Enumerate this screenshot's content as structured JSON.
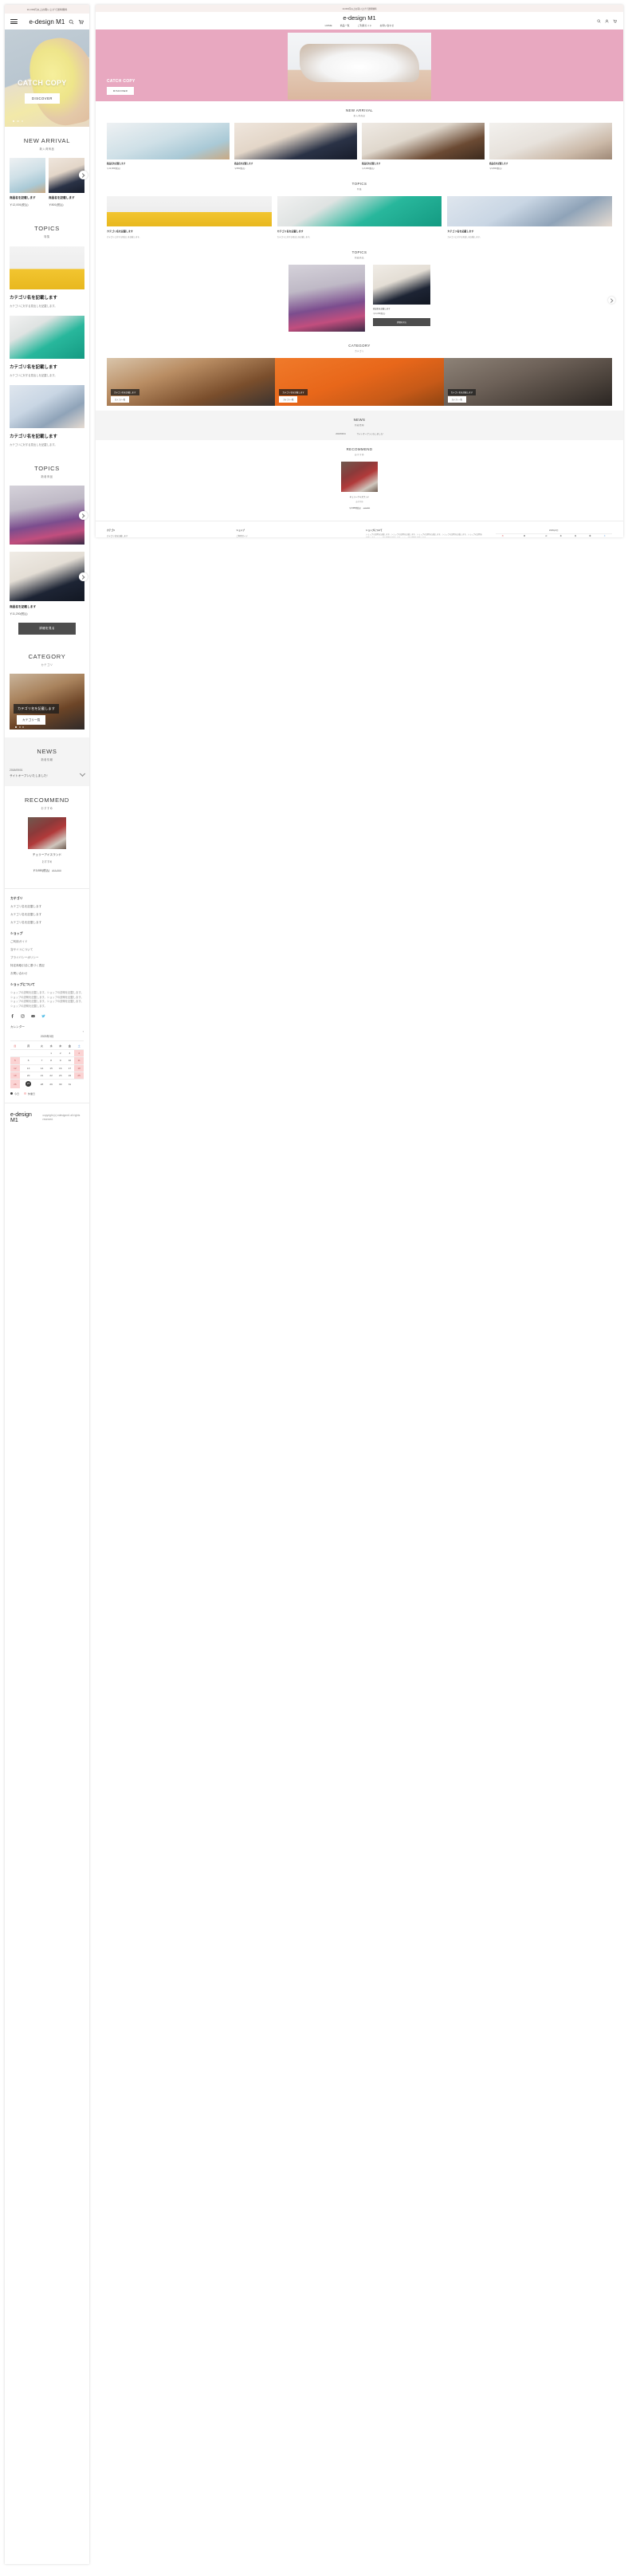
{
  "site": {
    "brand": "e-design M1",
    "announcement": "10,000円以上お買い上げで送料無料",
    "copyright": "copyright (c) edesignm1 all rights reserved."
  },
  "global_nav": [
    "HOME",
    "商品一覧",
    "ご利用ガイド",
    "お問い合わせ"
  ],
  "header_icons": [
    "search-icon",
    "user-icon",
    "cart-icon"
  ],
  "hero": {
    "catch_copy": "CATCH COPY",
    "button": "DISCOVER",
    "slide_count": 3,
    "active_slide": 1
  },
  "sections": {
    "new_arrival": {
      "en": "NEW ARRIVAL",
      "jp": "新入荷商品"
    },
    "topics": {
      "en": "TOPICS",
      "jp": "特集"
    },
    "topics_new": {
      "en": "TOPICS",
      "jp": "新着商品"
    },
    "category": {
      "en": "CATEGORY",
      "jp": "カテゴリ"
    },
    "news": {
      "en": "NEWS",
      "jp": "新着情報"
    },
    "recommend": {
      "en": "RECOMMEND",
      "jp": "おすすめ"
    }
  },
  "new_arrival_products": [
    {
      "name": "商品名を記載します",
      "price": "￥12,000(税込)"
    },
    {
      "name": "商品名を記載します",
      "price": "￥800(税込)"
    },
    {
      "name": "商品名を記載します",
      "price": "￥3,200(税込)"
    },
    {
      "name": "商品名を記載します",
      "price": "￥9,800(税込)"
    }
  ],
  "topics_categories": [
    {
      "title": "カテゴリ名を記載します",
      "subtitle": "カテゴリに対する見出しを記載します。"
    },
    {
      "title": "カテゴリ名を記載します",
      "subtitle": "カテゴリに対する見出しを記載します。"
    },
    {
      "title": "カテゴリ名を記載します",
      "subtitle": "カテゴリに対する見出しを記載します。"
    }
  ],
  "topics_new_products": [
    {
      "name": "商品名を記載します",
      "price": "￥11,200(税込)"
    }
  ],
  "topics_more_button": "詳細を見る",
  "category_banners": [
    {
      "label": "カテゴリ名を記載します",
      "button": "カテゴリ一覧"
    },
    {
      "label": "カテゴリ名を記載します",
      "button": "カテゴリ一覧"
    },
    {
      "label": "カテゴリ名を記載します",
      "button": "カテゴリ一覧"
    }
  ],
  "news_items": [
    {
      "date": "2018/09/01",
      "title": "サイトオープンいたしました!"
    }
  ],
  "recommend_product": {
    "name": "チェリーアイスランド",
    "tag": "おすすめ",
    "price": "￥3,080(税込)",
    "old_price": "￥3,300"
  },
  "footer": {
    "category_heading": "カテゴリ",
    "category_links": [
      "カテゴリ名を記載します",
      "カテゴリ名を記載します",
      "カテゴリ名を記載します"
    ],
    "shop_heading": "ショップ",
    "shop_links": [
      "ご利用ガイド",
      "当サイトについて",
      "プライバシーポリシー",
      "特定商取引法に基づく表記",
      "お問い合わせ"
    ],
    "about_heading": "ショップについて",
    "about_text": "ショップの説明を記載します。ショップの説明を記載します。ショップの説明を記載します。ショップの説明を記載します。ショップの説明を記載します。ショップの説明を記載します。ショップの説明を記載します。",
    "social": [
      "facebook-icon",
      "instagram-icon",
      "youtube-icon",
      "twitter-icon"
    ],
    "calendar_heading": "カレンダー"
  },
  "calendar": {
    "month_label": "2023年3月",
    "weekdays": [
      "日",
      "月",
      "火",
      "水",
      "木",
      "金",
      "土"
    ],
    "weeks": [
      [
        null,
        null,
        null,
        1,
        2,
        3,
        4
      ],
      [
        5,
        6,
        7,
        8,
        9,
        10,
        11
      ],
      [
        12,
        13,
        14,
        15,
        16,
        17,
        18
      ],
      [
        19,
        20,
        21,
        22,
        23,
        24,
        25
      ],
      [
        26,
        27,
        28,
        29,
        30,
        31,
        null
      ]
    ],
    "holidays": [
      4,
      5,
      11,
      12,
      18,
      19,
      25,
      26
    ],
    "today": 27,
    "legend_today": "今日",
    "legend_holiday": "休業日"
  },
  "colors": {
    "announcement_bg": "#f7f0ee",
    "hero_desktop_bg": "#e8a8c0",
    "dark_button": "#4d4d4d",
    "holiday": "#fbd3d3",
    "section_grey": "#f4f4f4"
  }
}
